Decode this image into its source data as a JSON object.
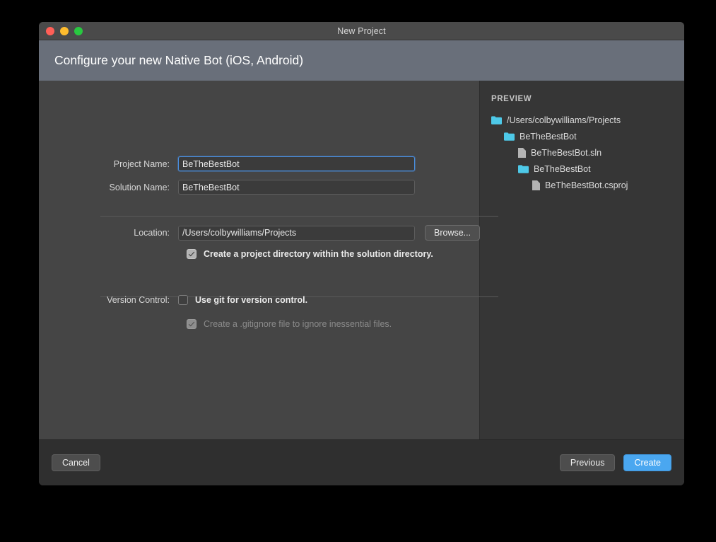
{
  "window": {
    "title": "New Project",
    "traffic_lights": [
      "close",
      "minimize",
      "zoom"
    ]
  },
  "header": {
    "title": "Configure your new Native Bot (iOS, Android)",
    "background_color": "#696f7a"
  },
  "form": {
    "project_name": {
      "label": "Project Name:",
      "value": "BeTheBestBot",
      "placeholder": "",
      "focused": true
    },
    "solution_name": {
      "label": "Solution Name:",
      "value": "BeTheBestBot",
      "placeholder": "",
      "focused": false
    },
    "location": {
      "label": "Location:",
      "value": "/Users/colbywilliams/Projects",
      "placeholder": "",
      "browse_label": "Browse..."
    },
    "project_directory": {
      "label": "Create a project directory within the solution directory.",
      "checked": true,
      "enabled": true
    },
    "version_control": {
      "label": "Version Control:",
      "use_git": {
        "label": "Use git for version control.",
        "checked": false,
        "enabled": true
      },
      "gitignore": {
        "label": "Create a .gitignore file to ignore inessential files.",
        "checked": true,
        "enabled": false
      }
    }
  },
  "preview": {
    "heading": "PREVIEW",
    "tree": [
      {
        "label": "/Users/colbywilliams/Projects",
        "icon": "folder-icon",
        "depth": 0
      },
      {
        "label": "BeTheBestBot",
        "icon": "folder-icon",
        "depth": 1
      },
      {
        "label": "BeTheBestBot.sln",
        "icon": "file-icon",
        "depth": 2
      },
      {
        "label": "BeTheBestBot",
        "icon": "folder-icon",
        "depth": 2
      },
      {
        "label": "BeTheBestBot.csproj",
        "icon": "file-icon",
        "depth": 3
      }
    ],
    "folder_color": "#4ec9e8",
    "file_color": "#b4b4b4"
  },
  "footer": {
    "cancel_label": "Cancel",
    "previous_label": "Previous",
    "create_label": "Create",
    "accent_color": "#4aa7f0"
  }
}
